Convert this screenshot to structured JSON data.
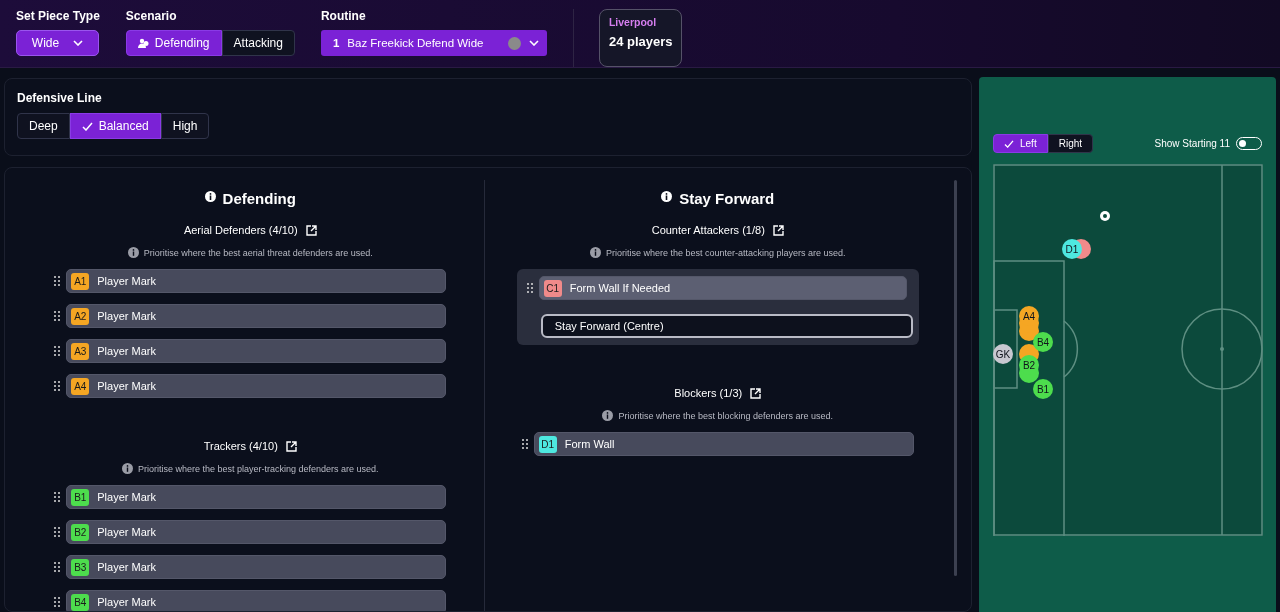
{
  "header": {
    "set_piece_type": {
      "label": "Set Piece Type",
      "value": "Wide"
    },
    "scenario": {
      "label": "Scenario",
      "options": [
        {
          "label": "Defending",
          "selected": true
        },
        {
          "label": "Attacking",
          "selected": false
        }
      ]
    },
    "routine": {
      "label": "Routine",
      "number": "1",
      "name": "Baz Freekick Defend Wide"
    },
    "team": {
      "name": "Liverpool",
      "players": "24 players"
    }
  },
  "defensive_line": {
    "label": "Defensive Line",
    "options": [
      {
        "label": "Deep",
        "selected": false
      },
      {
        "label": "Balanced",
        "selected": true
      },
      {
        "label": "High",
        "selected": false
      }
    ]
  },
  "columns": [
    {
      "title": "Defending",
      "groups": [
        {
          "title": "Aerial Defenders (4/10)",
          "hint": "Prioritise where the best aerial threat defenders are used.",
          "items": [
            {
              "tag": "A1",
              "color": "#f5a623",
              "label": "Player Mark"
            },
            {
              "tag": "A2",
              "color": "#f5a623",
              "label": "Player Mark"
            },
            {
              "tag": "A3",
              "color": "#f5a623",
              "label": "Player Mark"
            },
            {
              "tag": "A4",
              "color": "#f5a623",
              "label": "Player Mark"
            }
          ]
        },
        {
          "title": "Trackers (4/10)",
          "hint": "Prioritise where the best player-tracking defenders are used.",
          "items": [
            {
              "tag": "B1",
              "color": "#4ddd4d",
              "label": "Player Mark"
            },
            {
              "tag": "B2",
              "color": "#4ddd4d",
              "label": "Player Mark"
            },
            {
              "tag": "B3",
              "color": "#4ddd4d",
              "label": "Player Mark"
            },
            {
              "tag": "B4",
              "color": "#4ddd4d",
              "label": "Player Mark"
            }
          ]
        }
      ]
    },
    {
      "title": "Stay Forward",
      "groups": [
        {
          "title": "Counter Attackers (1/8)",
          "hint": "Prioritise where the best counter-attacking players are used.",
          "items": [
            {
              "tag": "C1",
              "color": "#f08a8a",
              "label": "Form Wall If Needed",
              "option": "Stay Forward (Centre)"
            }
          ]
        },
        {
          "title": "Blockers (1/3)",
          "hint": "Prioritise where the best blocking defenders are used.",
          "items": [
            {
              "tag": "D1",
              "color": "#4ee8e0",
              "label": "Form Wall"
            }
          ]
        }
      ]
    }
  ],
  "pitch": {
    "sides": [
      {
        "label": "Left",
        "selected": true
      },
      {
        "label": "Right",
        "selected": false
      }
    ],
    "show_starting_11": {
      "label": "Show Starting 11",
      "on": false
    },
    "markers": [
      {
        "color": "#f08a8a"
      },
      {
        "label": "D1",
        "color": "#4ee8e0"
      },
      {
        "color": "#f5a623"
      },
      {
        "color": "#f5a623"
      },
      {
        "label": "A4",
        "color": "#f5a623"
      },
      {
        "color": "#f5a623"
      },
      {
        "color": "#4ddd4d"
      },
      {
        "label": "B2",
        "color": "#4ddd4d"
      },
      {
        "label": "B4",
        "color": "#4ddd4d"
      },
      {
        "label": "B1",
        "color": "#4ddd4d"
      },
      {
        "label": "GK",
        "color": "#c8c8d0"
      }
    ]
  }
}
